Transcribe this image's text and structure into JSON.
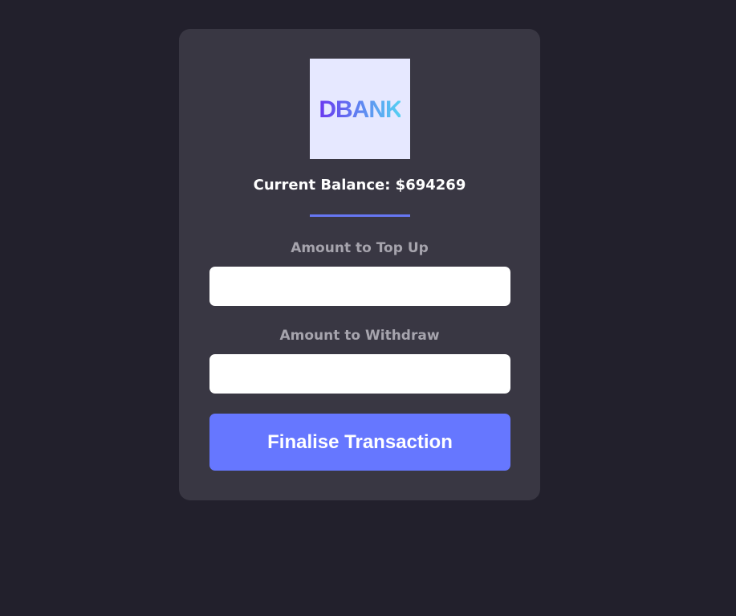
{
  "logo": {
    "text": "DBANK",
    "colors": {
      "start": "#6a38f0",
      "end": "#55d4f2"
    }
  },
  "balance": {
    "text": "Current Balance: $694269"
  },
  "form": {
    "topup_label": "Amount to Top Up",
    "topup_value": "",
    "withdraw_label": "Amount to Withdraw",
    "withdraw_value": "",
    "submit_label": "Finalise Transaction"
  },
  "colors": {
    "background": "#22202c",
    "card": "#393743",
    "accent": "#6677ff"
  }
}
